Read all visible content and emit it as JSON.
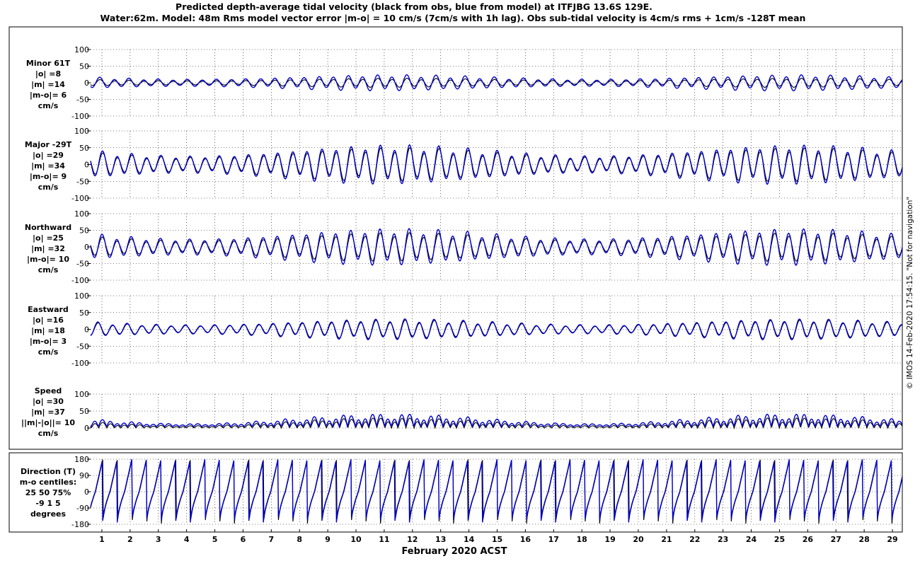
{
  "title_line1": "Predicted depth-average tidal velocity (black from obs, blue from model) at ITFJBG 13.6S 129E.",
  "title_line2": "Water:62m. Model: 48m  Rms model vector error |m-o| = 10 cm/s (7cm/s with 1h lag). Obs sub-tidal velocity is 4cm/s rms + 1cm/s -128T mean",
  "xlabel": "February 2020 ACST",
  "credit": "© IMOS 14-Feb-2020 17:54:15.  \"Not for navigation\"",
  "colors": {
    "obs": "#000000",
    "model": "#0000cc",
    "grid": "#000000"
  },
  "chart_data": {
    "type": "line",
    "x_unit": "day of February 2020 (ACST)",
    "x_range": [
      0.6,
      29.35
    ],
    "x_ticks": [
      "1",
      "2",
      "3",
      "4",
      "5",
      "6",
      "7",
      "8",
      "9",
      "10",
      "11",
      "12",
      "13",
      "14",
      "15",
      "16",
      "17",
      "18",
      "19",
      "20",
      "21",
      "22",
      "23",
      "24",
      "25",
      "26",
      "27",
      "28",
      "29"
    ],
    "legend": "black from obs, blue from model",
    "grid": true,
    "panels": [
      {
        "id": "minor",
        "label_lines": [
          "Minor 61T",
          "|o| =8",
          "|m| =14",
          "|m-o|= 6",
          "cm/s"
        ],
        "ylim": [
          -100,
          100
        ],
        "yticks": [
          "100",
          "50",
          "0",
          "-50",
          "-100"
        ],
        "amp_obs": 8,
        "amp_model": 14,
        "phase": 1.2
      },
      {
        "id": "major",
        "label_lines": [
          "Major -29T",
          "|o| =29",
          "|m| =34",
          "|m-o|= 9",
          "cm/s"
        ],
        "ylim": [
          -100,
          100
        ],
        "yticks": [
          "100",
          "50",
          "0",
          "-50",
          "-100"
        ],
        "amp_obs": 29,
        "amp_model": 34,
        "phase": 0.0
      },
      {
        "id": "northward",
        "label_lines": [
          "Northward",
          "|o| =25",
          "|m| =32",
          "|m-o|= 10",
          "cm/s"
        ],
        "ylim": [
          -100,
          100
        ],
        "yticks": [
          "100",
          "50",
          "0",
          "-50",
          "-100"
        ],
        "amp_obs": 25,
        "amp_model": 32,
        "phase": 0.2
      },
      {
        "id": "eastward",
        "label_lines": [
          "Eastward",
          "|o| =16",
          "|m| =18",
          "|m-o|= 3",
          "cm/s"
        ],
        "ylim": [
          -100,
          100
        ],
        "yticks": [
          "100",
          "50",
          "0",
          "-50",
          "-100"
        ],
        "amp_obs": 16,
        "amp_model": 18,
        "phase": 2.0
      },
      {
        "id": "speed",
        "label_lines": [
          "Speed",
          "|o| =30",
          "|m| =37",
          "||m|-|o||= 10",
          "cm/s"
        ],
        "ylim": [
          0,
          100
        ],
        "yticks": [
          "100",
          "50",
          "0"
        ],
        "amp_obs": 30,
        "amp_model": 37,
        "phase": 0.0
      },
      {
        "id": "direction",
        "label_lines": [
          "Direction (T)",
          "m-o centiles:",
          "25  50  75%",
          "-9   1   5",
          "degrees"
        ],
        "ylim": [
          -180,
          180
        ],
        "yticks": [
          "180",
          "90",
          "0",
          "-90",
          "-180"
        ],
        "amp_obs": 180,
        "amp_model": 180,
        "phase": 0.0
      }
    ]
  }
}
